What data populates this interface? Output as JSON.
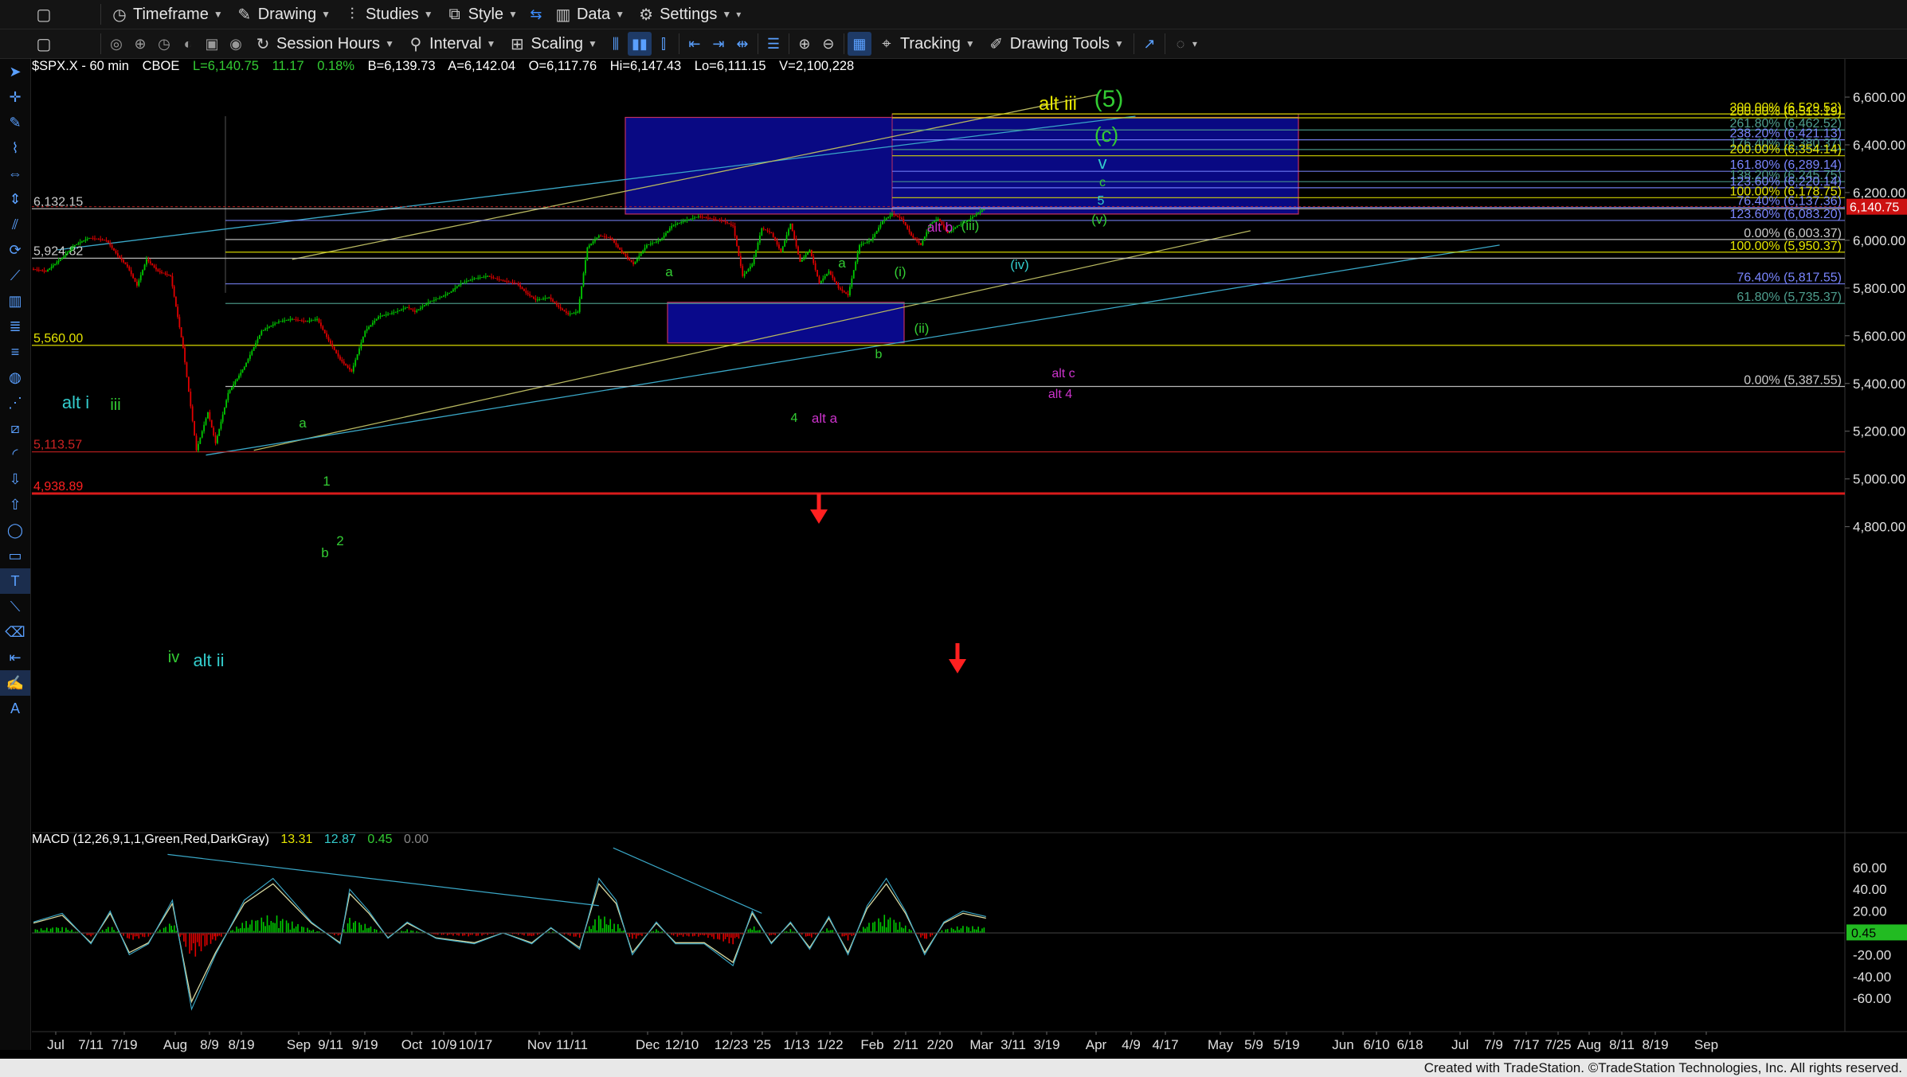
{
  "toolbar1": [
    {
      "name": "timeframe-menu",
      "icon": "clock-icon",
      "label": "Timeframe"
    },
    {
      "name": "drawing-menu",
      "icon": "pencil-icon",
      "label": "Drawing"
    },
    {
      "name": "studies-menu",
      "icon": "studies-icon",
      "label": "Studies"
    },
    {
      "name": "style-menu",
      "icon": "style-icon",
      "label": "Style"
    },
    {
      "name": "data-menu",
      "icon": "data-icon",
      "label": "Data"
    },
    {
      "name": "settings-menu",
      "icon": "gear-icon",
      "label": "Settings"
    }
  ],
  "toolbar2": {
    "session_hours": "Session Hours",
    "interval": "Interval",
    "scaling": "Scaling",
    "tracking": "Tracking",
    "drawing_tools": "Drawing Tools"
  },
  "symbol_line": {
    "symbol": "$SPX.X - 60 min",
    "exchange": "CBOE",
    "last": "L=6,140.75",
    "change": "11.17",
    "change_pct": "0.18%",
    "bid": "B=6,139.73",
    "ask": "A=6,142.04",
    "open": "O=6,117.76",
    "high": "Hi=6,147.43",
    "low": "Lo=6,111.15",
    "volume": "V=2,100,228"
  },
  "macd_line": {
    "label": "MACD (12,26,9,1,1,Green,Red,DarkGray)",
    "v1": "13.31",
    "v2": "12.87",
    "v3": "0.45",
    "v4": "0.00"
  },
  "colors": {
    "up": "#00c800",
    "down": "#e00000",
    "fib_yellow": "#e6e600",
    "fib_blue": "#7a86ff",
    "zone": "#0a0a9a",
    "wave_green": "#33cc33",
    "wave_magenta": "#cc33cc",
    "wave_cyan": "#33cccc",
    "trend_cyan": "#3aa8c8",
    "trend_yellow": "#b8b860"
  },
  "chart_data": {
    "type": "line",
    "price_axis": {
      "labels": [
        "6,600.00",
        "6,400.00",
        "6,200.00",
        "6,000.00",
        "5,800.00",
        "5,600.00",
        "5,400.00",
        "5,200.00",
        "5,000.00",
        "4,800.00"
      ],
      "range": [
        4720,
        6620
      ]
    },
    "macd_axis": {
      "labels": [
        "60.00",
        "40.00",
        "20.00",
        "-20.00",
        "-40.00",
        "-60.00"
      ],
      "range": [
        -75,
        75
      ],
      "current_tag": "0.45"
    },
    "last_price_tag": "6,140.75",
    "time_axis": [
      "Jul",
      "7/11",
      "7/19",
      "Aug",
      "8/9",
      "8/19",
      "Sep",
      "9/11",
      "9/19",
      "Oct",
      "10/9",
      "10/17",
      "Nov",
      "11/11",
      "Dec",
      "12/10",
      "12/23",
      "'25",
      "1/13",
      "1/22",
      "Feb",
      "2/11",
      "2/20",
      "Mar",
      "3/11",
      "3/19",
      "Apr",
      "4/9",
      "4/17",
      "May",
      "5/9",
      "5/19",
      "Jun",
      "6/10",
      "6/18",
      "Jul",
      "7/9",
      "7/17",
      "7/25",
      "Aug",
      "8/11",
      "8/19",
      "Sep"
    ],
    "price_path": [
      [
        0,
        5880
      ],
      [
        15,
        5870
      ],
      [
        30,
        5920
      ],
      [
        45,
        5980
      ],
      [
        60,
        6010
      ],
      [
        78,
        6000
      ],
      [
        90,
        5935
      ],
      [
        100,
        5890
      ],
      [
        110,
        5810
      ],
      [
        120,
        5920
      ],
      [
        132,
        5870
      ],
      [
        145,
        5850
      ],
      [
        158,
        5550
      ],
      [
        172,
        5120
      ],
      [
        184,
        5280
      ],
      [
        192,
        5150
      ],
      [
        205,
        5360
      ],
      [
        222,
        5470
      ],
      [
        240,
        5620
      ],
      [
        258,
        5660
      ],
      [
        272,
        5670
      ],
      [
        286,
        5660
      ],
      [
        298,
        5670
      ],
      [
        310,
        5580
      ],
      [
        322,
        5500
      ],
      [
        334,
        5450
      ],
      [
        348,
        5620
      ],
      [
        362,
        5680
      ],
      [
        380,
        5700
      ],
      [
        392,
        5720
      ],
      [
        400,
        5700
      ],
      [
        414,
        5740
      ],
      [
        426,
        5760
      ],
      [
        436,
        5780
      ],
      [
        448,
        5820
      ],
      [
        462,
        5840
      ],
      [
        476,
        5850
      ],
      [
        492,
        5830
      ],
      [
        506,
        5820
      ],
      [
        516,
        5780
      ],
      [
        526,
        5750
      ],
      [
        540,
        5760
      ],
      [
        550,
        5720
      ],
      [
        560,
        5690
      ],
      [
        570,
        5700
      ],
      [
        580,
        5970
      ],
      [
        592,
        6020
      ],
      [
        604,
        6010
      ],
      [
        616,
        5950
      ],
      [
        628,
        5900
      ],
      [
        642,
        5980
      ],
      [
        656,
        6000
      ],
      [
        668,
        6060
      ],
      [
        680,
        6080
      ],
      [
        696,
        6100
      ],
      [
        710,
        6090
      ],
      [
        722,
        6080
      ],
      [
        732,
        6060
      ],
      [
        742,
        5850
      ],
      [
        752,
        5900
      ],
      [
        762,
        6050
      ],
      [
        772,
        6030
      ],
      [
        782,
        5950
      ],
      [
        792,
        6070
      ],
      [
        802,
        5910
      ],
      [
        812,
        5960
      ],
      [
        822,
        5820
      ],
      [
        832,
        5870
      ],
      [
        842,
        5800
      ],
      [
        852,
        5770
      ],
      [
        864,
        5980
      ],
      [
        876,
        6000
      ],
      [
        888,
        6080
      ],
      [
        898,
        6110
      ],
      [
        908,
        6090
      ],
      [
        918,
        6020
      ],
      [
        928,
        5980
      ],
      [
        938,
        6070
      ],
      [
        946,
        6090
      ],
      [
        956,
        6030
      ],
      [
        966,
        6060
      ],
      [
        976,
        6080
      ],
      [
        986,
        6110
      ],
      [
        994,
        6130
      ]
    ],
    "macd_signal_path": [
      [
        0,
        10
      ],
      [
        30,
        18
      ],
      [
        60,
        -10
      ],
      [
        80,
        20
      ],
      [
        100,
        -20
      ],
      [
        120,
        -10
      ],
      [
        145,
        30
      ],
      [
        165,
        -70
      ],
      [
        190,
        -20
      ],
      [
        220,
        30
      ],
      [
        250,
        50
      ],
      [
        270,
        30
      ],
      [
        290,
        10
      ],
      [
        320,
        -10
      ],
      [
        330,
        40
      ],
      [
        350,
        20
      ],
      [
        370,
        -5
      ],
      [
        390,
        10
      ],
      [
        420,
        -5
      ],
      [
        460,
        -10
      ],
      [
        490,
        0
      ],
      [
        520,
        -10
      ],
      [
        540,
        5
      ],
      [
        570,
        -15
      ],
      [
        590,
        50
      ],
      [
        608,
        30
      ],
      [
        625,
        -20
      ],
      [
        650,
        10
      ],
      [
        670,
        -10
      ],
      [
        700,
        -10
      ],
      [
        730,
        -30
      ],
      [
        750,
        20
      ],
      [
        770,
        -10
      ],
      [
        790,
        10
      ],
      [
        810,
        -15
      ],
      [
        830,
        15
      ],
      [
        850,
        -20
      ],
      [
        870,
        25
      ],
      [
        890,
        50
      ],
      [
        910,
        20
      ],
      [
        930,
        -20
      ],
      [
        950,
        10
      ],
      [
        970,
        20
      ],
      [
        994,
        15
      ]
    ],
    "fib_levels": [
      {
        "label": "300.00% (6,529.52)",
        "color": "#e6e600"
      },
      {
        "label": "200.00% (6,513.19)",
        "color": "#e6e600"
      },
      {
        "label": "261.80% (6,462.52)",
        "color": "#4e9e8e"
      },
      {
        "label": "238.20% (6,421.13)",
        "color": "#7a86ff"
      },
      {
        "label": "176.40% (6,380.37)",
        "color": "#4e9e8e"
      },
      {
        "label": "200.00% (6,354.14)",
        "color": "#e6e600"
      },
      {
        "label": "161.80% (6,289.14)",
        "color": "#7a86ff"
      },
      {
        "label": "138.20% (6,245.75)",
        "color": "#4e9e8e"
      },
      {
        "label": "123.60% (6,220.14)",
        "color": "#7a86ff"
      },
      {
        "label": "100.00% (6,178.75)",
        "color": "#e6e600"
      },
      {
        "label": "76.40% (6,137.36)",
        "color": "#7a86ff"
      },
      {
        "label": "123.60% (6,083.20)",
        "color": "#7a86ff"
      },
      {
        "label": "0.00% (6,003.37)",
        "color": "#cccccc"
      },
      {
        "label": "100.00% (5,950.37)",
        "color": "#e6e600"
      },
      {
        "label": "76.40% (5,817.55)",
        "color": "#7a86ff"
      },
      {
        "label": "61.80% (5,735.37)",
        "color": "#4e9e8e"
      },
      {
        "label": "0.00% (5,387.55)",
        "color": "#cccccc"
      }
    ],
    "horizontal_levels": [
      {
        "label": "6,132.15",
        "color": "#cccccc"
      },
      {
        "label": "5,924.82",
        "color": "#cccccc"
      },
      {
        "label": "5,560.00",
        "color": "#e6e600"
      },
      {
        "label": "5,113.57",
        "color": "#cc2222"
      },
      {
        "label": "4,938.89",
        "color": "#ff2020"
      }
    ],
    "wave_labels": [
      {
        "text": "alt i",
        "color": "#33cccc"
      },
      {
        "text": "iii",
        "color": "#33cc33"
      },
      {
        "text": "iv",
        "color": "#33cc33"
      },
      {
        "text": "alt ii",
        "color": "#33cccc"
      },
      {
        "text": "a",
        "color": "#33cc33"
      },
      {
        "text": "1",
        "color": "#33cc33"
      },
      {
        "text": "b",
        "color": "#33cc33"
      },
      {
        "text": "2",
        "color": "#33cc33"
      },
      {
        "text": "a",
        "color": "#33cc33"
      },
      {
        "text": "a",
        "color": "#33cc33"
      },
      {
        "text": "4",
        "color": "#33cc33"
      },
      {
        "text": "alt a",
        "color": "#cc33cc"
      },
      {
        "text": "b",
        "color": "#33cc33"
      },
      {
        "text": "(i)",
        "color": "#33cc33"
      },
      {
        "text": "(ii)",
        "color": "#33cc33"
      },
      {
        "text": "alt b",
        "color": "#cc33cc"
      },
      {
        "text": "(iii)",
        "color": "#33cc33"
      },
      {
        "text": "(iv)",
        "color": "#33cccc"
      },
      {
        "text": "(v)",
        "color": "#33cc33"
      },
      {
        "text": "5",
        "color": "#33cccc"
      },
      {
        "text": "c",
        "color": "#33cc33"
      },
      {
        "text": "v",
        "color": "#33cccc"
      },
      {
        "text": "(c)",
        "color": "#33cc33"
      },
      {
        "text": "alt iii",
        "color": "#e6e600"
      },
      {
        "text": "(5)",
        "color": "#33cc33"
      },
      {
        "text": "alt c",
        "color": "#cc33cc"
      },
      {
        "text": "alt 4",
        "color": "#cc33cc"
      }
    ]
  },
  "footer": "Created with TradeStation. ©TradeStation Technologies, Inc. All rights reserved."
}
